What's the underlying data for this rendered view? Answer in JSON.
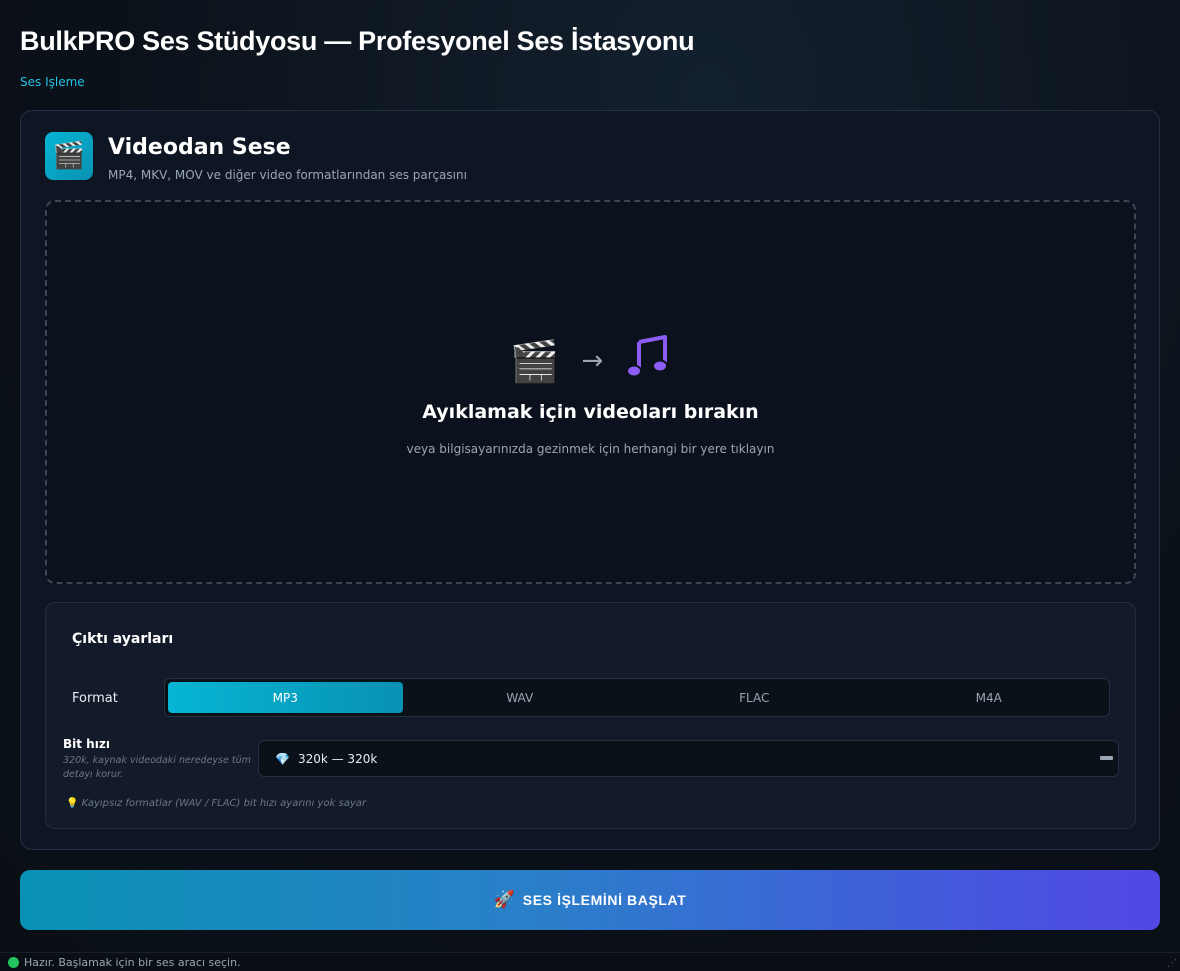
{
  "app": {
    "title": "BulkPRO Ses Stüdyosu — Profesyonel Ses İstasyonu",
    "breadcrumb": "Ses Işleme"
  },
  "tool": {
    "icon": "clapper-board-icon",
    "title": "Videodan Sese",
    "subtitle": "MP4, MKV, MOV ve diğer video formatlarından ses parçasını"
  },
  "dropzone": {
    "icons": [
      "clapper-board-icon",
      "arrow-right-icon",
      "music-note-icon"
    ],
    "arrow": "→",
    "title": "Ayıklamak için videoları bırakın",
    "hint": "veya bilgisayarınızda gezinmek için herhangi bir yere tıklayın"
  },
  "settings": {
    "title": "Çıktı ayarları",
    "format_label": "Format",
    "formats": [
      "MP3",
      "WAV",
      "FLAC",
      "M4A"
    ],
    "selected_format": "MP3",
    "bitrate_label": "Bit hızı",
    "bitrate_help": "320k, kaynak videodaki neredeyse tüm detayı korur.",
    "bitrate_value": "320k — 320k",
    "bitrate_icon": "gem-icon",
    "note": "Kayıpsız formatlar (WAV / FLAC) bit hızı ayarını yok sayar"
  },
  "action": {
    "start_label": "SES İŞLEMİNİ BAŞLAT",
    "start_icon": "rocket-icon"
  },
  "status": {
    "text": "Hazır. Başlamak için bir ses aracı seçin.",
    "color": "#22c55e"
  },
  "colors": {
    "accent": "#06b6d4",
    "accent_end": "#5147e5",
    "background": "#0b1119"
  }
}
